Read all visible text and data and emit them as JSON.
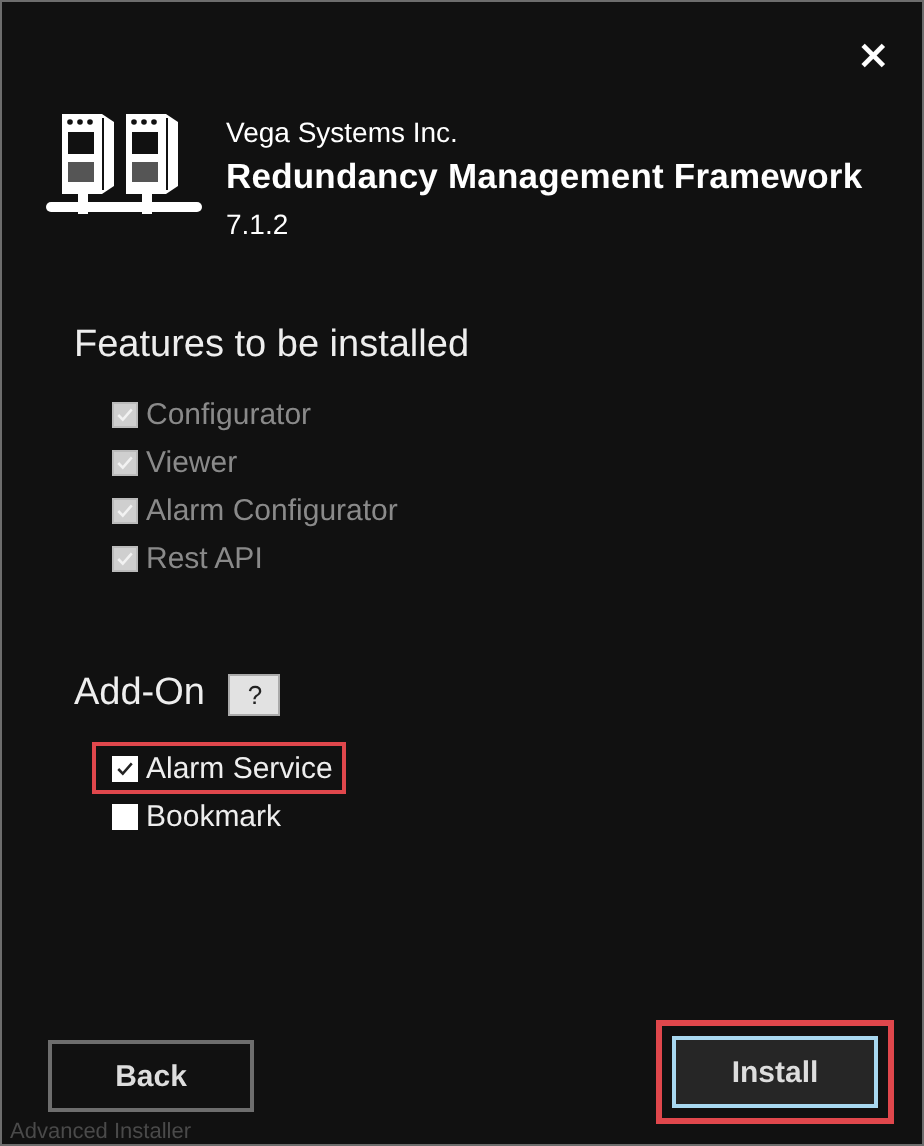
{
  "window": {
    "close_label": "×"
  },
  "header": {
    "company": "Vega Systems Inc.",
    "product": "Redundancy Management Framework",
    "version": "7.1.2"
  },
  "features": {
    "heading": "Features to be installed",
    "items": [
      {
        "label": "Configurator",
        "checked": true,
        "disabled": true,
        "highlighted": false
      },
      {
        "label": "Viewer",
        "checked": true,
        "disabled": true,
        "highlighted": false
      },
      {
        "label": "Alarm Configurator",
        "checked": true,
        "disabled": true,
        "highlighted": false
      },
      {
        "label": "Rest API",
        "checked": true,
        "disabled": true,
        "highlighted": false
      }
    ]
  },
  "addon": {
    "heading": "Add-On",
    "help_label": "?",
    "items": [
      {
        "label": "Alarm Service",
        "checked": true,
        "disabled": false,
        "highlighted": true
      },
      {
        "label": "Bookmark",
        "checked": false,
        "disabled": false,
        "highlighted": false
      }
    ]
  },
  "footer": {
    "back": {
      "label": "Back",
      "highlighted": false
    },
    "install": {
      "label": "Install",
      "highlighted": true
    },
    "brand": "Advanced Installer"
  }
}
